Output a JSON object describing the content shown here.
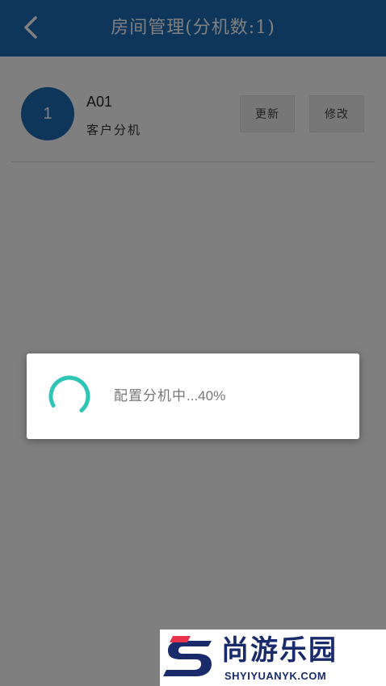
{
  "header": {
    "title": "房间管理(分机数:1)",
    "back_icon": "chevron-left-icon",
    "background_color": "#1d6db6"
  },
  "rooms": [
    {
      "index": "1",
      "name": "A01",
      "type": "客户分机",
      "update_label": "更新",
      "modify_label": "修改"
    }
  ],
  "dialog": {
    "message": "配置分机中",
    "ellipsis": "...",
    "progress_text": "40%",
    "progress": 0.4,
    "spinner_color": "#2ec4b6"
  },
  "watermark": {
    "brand": "尚游乐园",
    "url": "SHYIYUANYK.COM"
  }
}
